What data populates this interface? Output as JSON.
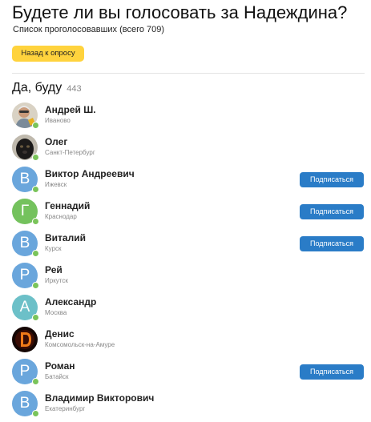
{
  "header": {
    "title": "Будете ли вы голосовать за Надеждина?",
    "subtitle": "Список проголосовавших (всего 709)",
    "back_label": "Назад к опросу"
  },
  "section": {
    "answer": "Да, буду",
    "count": "443"
  },
  "subscribe_label": "Подписаться",
  "colors": {
    "accent_yellow": "#ffd33d",
    "subscribe_blue": "#2a7cc7",
    "online_green": "#7ac45a",
    "avatar_blue": "#6aa6dc",
    "avatar_green": "#74c25d",
    "avatar_teal": "#6cc0c8"
  },
  "voters": [
    {
      "name": "Андрей Ш.",
      "city": "Иваново",
      "avatar": "photo-portrait-icon",
      "initial": "",
      "online": true,
      "subscribe": false
    },
    {
      "name": "Олег",
      "city": "Санкт-Петербург",
      "avatar": "photo-dog-icon",
      "initial": "",
      "online": true,
      "subscribe": false
    },
    {
      "name": "Виктор Андреевич",
      "city": "Ижевск",
      "avatar": "letter",
      "initial": "В",
      "online": true,
      "subscribe": true
    },
    {
      "name": "Геннадий",
      "city": "Краснодар",
      "avatar": "letter",
      "initial": "Г",
      "online": true,
      "subscribe": true
    },
    {
      "name": "Виталий",
      "city": "Курск",
      "avatar": "letter",
      "initial": "В",
      "online": true,
      "subscribe": true
    },
    {
      "name": "Рей",
      "city": "Иркутск",
      "avatar": "letter",
      "initial": "Р",
      "online": true,
      "subscribe": false
    },
    {
      "name": "Александр",
      "city": "Москва",
      "avatar": "letter",
      "initial": "А",
      "online": true,
      "subscribe": false
    },
    {
      "name": "Денис",
      "city": "Комсомольск-на-Амуре",
      "avatar": "photo-fire-letter-icon",
      "initial": "",
      "online": false,
      "subscribe": false
    },
    {
      "name": "Роман",
      "city": "Батайск",
      "avatar": "letter",
      "initial": "Р",
      "online": true,
      "subscribe": true
    },
    {
      "name": "Владимир Викторович",
      "city": "Екатеринбург",
      "avatar": "letter",
      "initial": "В",
      "online": true,
      "subscribe": false
    }
  ]
}
